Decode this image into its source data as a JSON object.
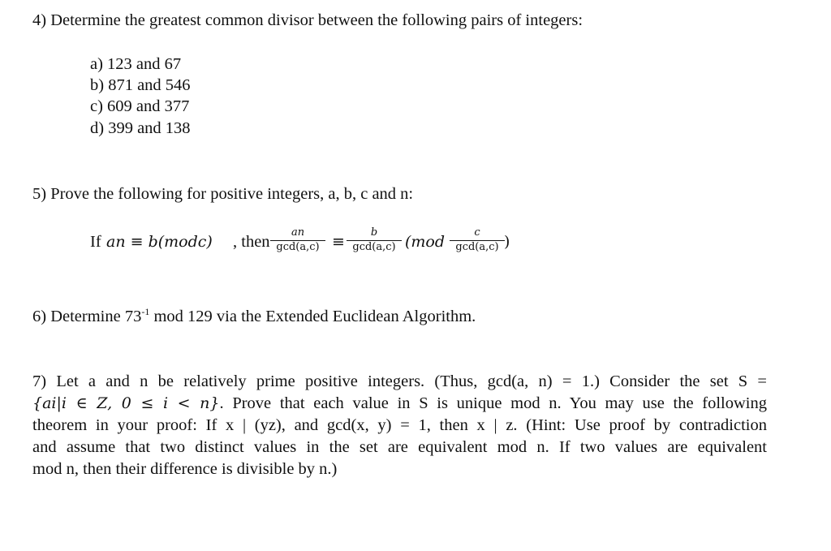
{
  "q4": {
    "prompt": "4) Determine the greatest common divisor between the following pairs of integers:",
    "items": [
      {
        "label": "a) 123 and 67"
      },
      {
        "label": "b) 871 and 546"
      },
      {
        "label": "c) 609 and 377"
      },
      {
        "label": "d) 399 and 138"
      }
    ]
  },
  "q5": {
    "prompt": "5) Prove the following for positive integers, a, b, c and n:",
    "formula": {
      "if_word": "If ",
      "lhs": "an ≡ b(modc)",
      "then_word": ", then",
      "frac1_num": "an",
      "frac_den": "gcd(a,c)",
      "equiv": "≡",
      "frac2_num": "b",
      "mod_open": "(mod",
      "frac3_num": "c",
      "mod_close": ")"
    }
  },
  "q6": {
    "prefix": "6) Determine 73",
    "exponent": "-1",
    "suffix": " mod 129 via the Extended Euclidean Algorithm."
  },
  "q7": {
    "line1": "7) Let a and n be relatively prime positive integers. (Thus, gcd(a, n) = 1.) Consider the set S =",
    "line2_math": "{ai|i ∈ Z, 0 ≤ i < n}",
    "line2_text": ". Prove that each value in S is unique mod n. You may use the following",
    "line3": "theorem in your proof: If x | (yz), and gcd(x, y) = 1, then x | z. (Hint: Use proof by contradiction",
    "line4": "and assume that two distinct values in the set are equivalent mod n. If two values are equivalent",
    "line5": "mod n, then their difference is divisible by n.)"
  }
}
